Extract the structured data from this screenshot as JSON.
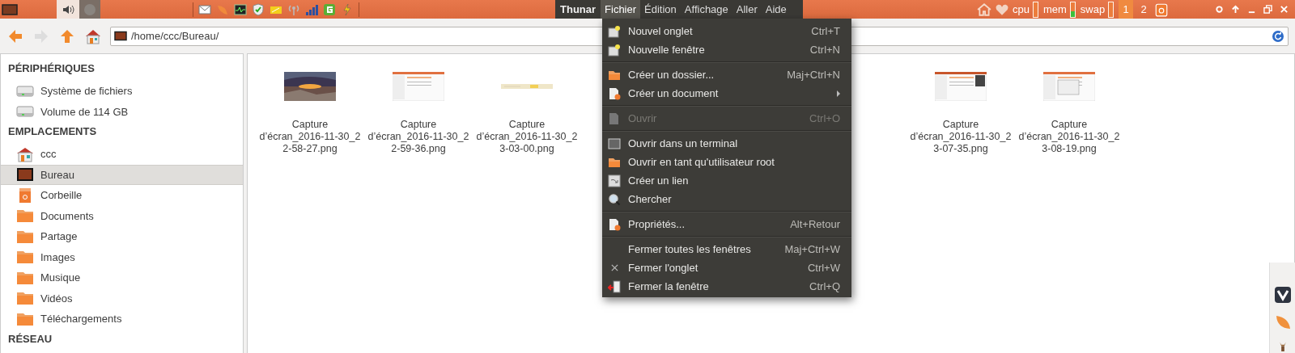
{
  "top_panel": {
    "app_name": "Thunar",
    "menus": [
      {
        "label": "Fichier",
        "selected": true
      },
      {
        "label": "Édition",
        "selected": false
      },
      {
        "label": "Affichage",
        "selected": false
      },
      {
        "label": "Aller",
        "selected": false
      },
      {
        "label": "Aide",
        "selected": false
      }
    ],
    "meters": [
      {
        "label": "cpu",
        "level": 0
      },
      {
        "label": "mem",
        "level": 0.35
      },
      {
        "label": "swap",
        "level": 0
      }
    ],
    "workspaces": [
      {
        "label": "1",
        "selected": true
      },
      {
        "label": "2",
        "selected": false
      }
    ]
  },
  "toolbar": {
    "back_disabled": false,
    "forward_disabled": true,
    "location": "/home/ccc/Bureau/"
  },
  "sidebar": [
    {
      "heading": "PÉRIPHÉRIQUES",
      "items": [
        {
          "label": "Système de fichiers",
          "selected": false
        },
        {
          "label": "Volume de 114 GB",
          "selected": false
        }
      ]
    },
    {
      "heading": "EMPLACEMENTS",
      "items": [
        {
          "label": "ccc",
          "selected": false
        },
        {
          "label": "Bureau",
          "selected": true
        },
        {
          "label": "Corbeille",
          "selected": false
        },
        {
          "label": "Documents",
          "selected": false
        },
        {
          "label": "Partage",
          "selected": false
        },
        {
          "label": "Images",
          "selected": false
        },
        {
          "label": "Musique",
          "selected": false
        },
        {
          "label": "Vidéos",
          "selected": false
        },
        {
          "label": "Téléchargements",
          "selected": false
        }
      ]
    },
    {
      "heading": "RÉSEAU"
    }
  ],
  "files": [
    {
      "lines": [
        "Capture",
        "d’écran_2016-11-30_2",
        "2-58-27.png"
      ]
    },
    {
      "lines": [
        "Capture",
        "d’écran_2016-11-30_2",
        "2-59-36.png"
      ]
    },
    {
      "lines": [
        "Capture",
        "d’écran_2016-11-30_2",
        "3-03-00.png"
      ]
    },
    {
      "lines": [
        "Capture",
        "d’écran_2016-11-30_2",
        "3-07-35.png"
      ]
    },
    {
      "lines": [
        "Capture",
        "d’écran_2016-11-30_2",
        "3-08-19.png"
      ]
    }
  ],
  "file_menu": [
    {
      "kind": "item",
      "label": "Nouvel onglet",
      "shortcut": "Ctrl+T",
      "disabled": false
    },
    {
      "kind": "item",
      "label": "Nouvelle fenêtre",
      "shortcut": "Ctrl+N",
      "disabled": false
    },
    {
      "kind": "separator"
    },
    {
      "kind": "item",
      "label": "Créer un dossier...",
      "shortcut": "Maj+Ctrl+N",
      "disabled": false
    },
    {
      "kind": "submenu",
      "label": "Créer un document",
      "disabled": false
    },
    {
      "kind": "separator"
    },
    {
      "kind": "item",
      "label": "Ouvrir",
      "shortcut": "Ctrl+O",
      "disabled": true
    },
    {
      "kind": "separator"
    },
    {
      "kind": "item",
      "label": "Ouvrir dans un terminal",
      "disabled": false
    },
    {
      "kind": "item",
      "label": "Ouvrir en tant qu'utilisateur root",
      "disabled": false
    },
    {
      "kind": "item",
      "label": "Créer un lien",
      "disabled": false
    },
    {
      "kind": "item",
      "label": "Chercher",
      "disabled": false
    },
    {
      "kind": "separator"
    },
    {
      "kind": "item",
      "label": "Propriétés...",
      "shortcut": "Alt+Retour",
      "disabled": false
    },
    {
      "kind": "separator"
    },
    {
      "kind": "item",
      "label": "Fermer toutes les fenêtres",
      "shortcut": "Maj+Ctrl+W",
      "disabled": false
    },
    {
      "kind": "item",
      "label": "Fermer l'onglet",
      "shortcut": "Ctrl+W",
      "disabled": false
    },
    {
      "kind": "item",
      "label": "Fermer la fenêtre",
      "shortcut": "Ctrl+Q",
      "disabled": false
    }
  ]
}
